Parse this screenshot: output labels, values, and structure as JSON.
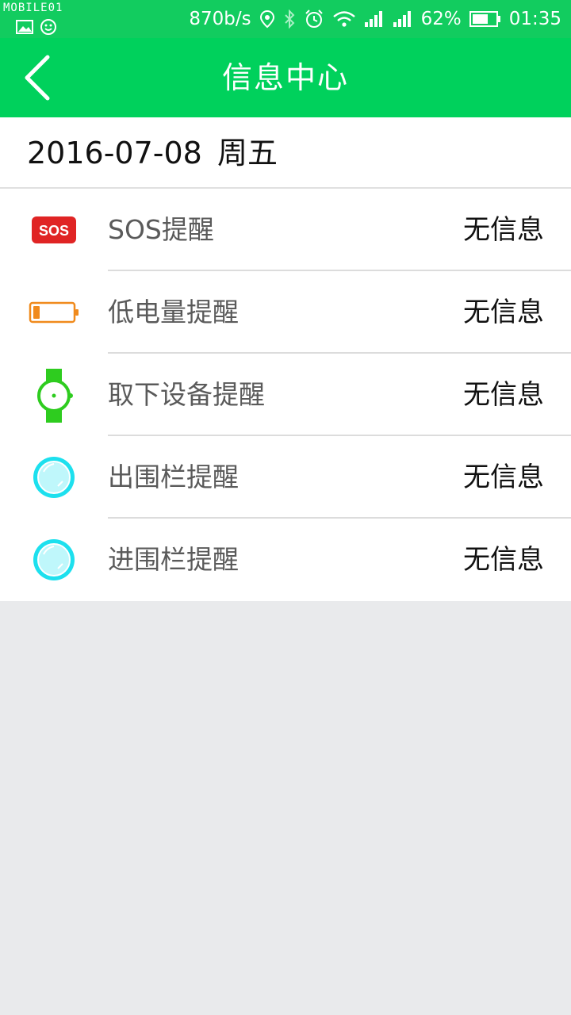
{
  "status_bar": {
    "watermark": "MOBILE01",
    "net_speed": "870b/s",
    "battery_percent": "62%",
    "time": "01:35"
  },
  "header": {
    "title": "信息中心",
    "back_icon": "chevron-left-icon"
  },
  "date_bar": {
    "date": "2016-07-08",
    "weekday": "周五"
  },
  "list": [
    {
      "label": "SOS提醒",
      "value": "无信息",
      "icon": "sos-icon"
    },
    {
      "label": "低电量提醒",
      "value": "无信息",
      "icon": "low-battery-icon"
    },
    {
      "label": "取下设备提醒",
      "value": "无信息",
      "icon": "watch-icon"
    },
    {
      "label": "出围栏提醒",
      "value": "无信息",
      "icon": "geofence-exit-icon"
    },
    {
      "label": "进围栏提醒",
      "value": "无信息",
      "icon": "geofence-enter-icon"
    }
  ],
  "colors": {
    "header_bg": "#00d15c",
    "sos_red": "#e02424",
    "battery_orange": "#f08a1c",
    "watch_green": "#2ecc1f",
    "geofence_cyan": "#1de0ee"
  }
}
